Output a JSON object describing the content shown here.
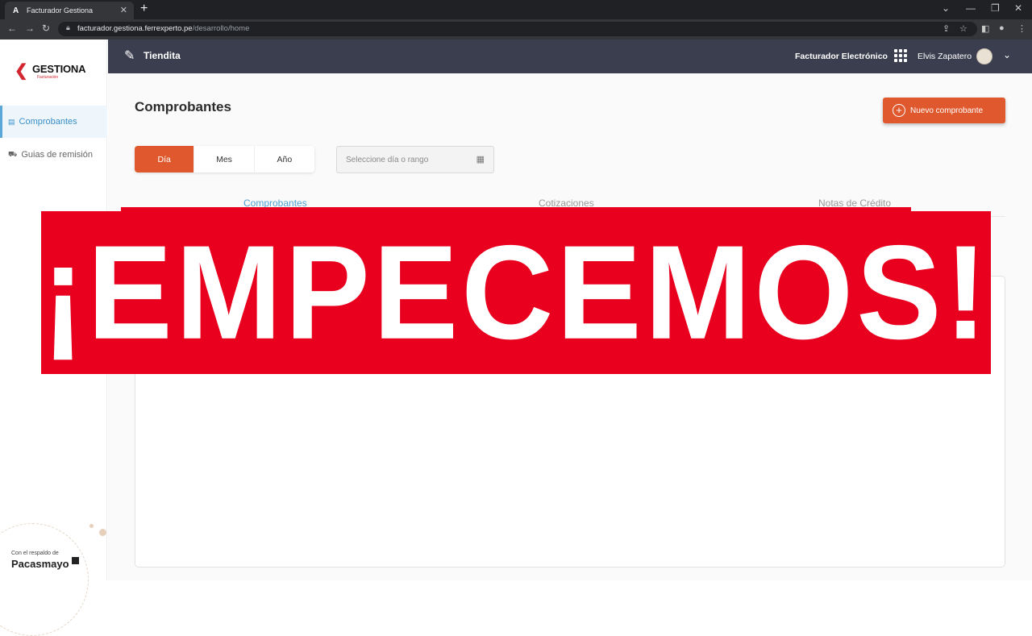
{
  "browser": {
    "tab_title": "Facturador Gestiona",
    "url_host": "facturador.gestiona.ferrexperto.pe",
    "url_path": "/desarrollo/home"
  },
  "sidebar": {
    "logo_text": "GESTIONA",
    "logo_sub": "Facturación",
    "items": [
      {
        "label": "Comprobantes",
        "active": true
      },
      {
        "label": "Guias de remisión",
        "active": false
      }
    ],
    "backed_by": "Con el respaldo de",
    "partner": "Pacasmayo"
  },
  "topbar": {
    "store_name": "Tiendita",
    "billing_label": "Facturador Electrónico",
    "user_name": "Elvis Zapatero"
  },
  "main": {
    "title": "Comprobantes",
    "new_button": "Nuevo comprobante",
    "period": [
      "Día",
      "Mes",
      "Año"
    ],
    "date_placeholder": "Seleccione día o rango",
    "tabs": [
      "Comprobantes",
      "Cotizaciones",
      "Notas de Crédito"
    ]
  },
  "banner": {
    "text": "¡EMPECEMOS!"
  },
  "colors": {
    "accent": "#e0592e",
    "topbar": "#3b3e4f",
    "banner": "#e8001e",
    "active_tab": "#4f9ed1"
  }
}
